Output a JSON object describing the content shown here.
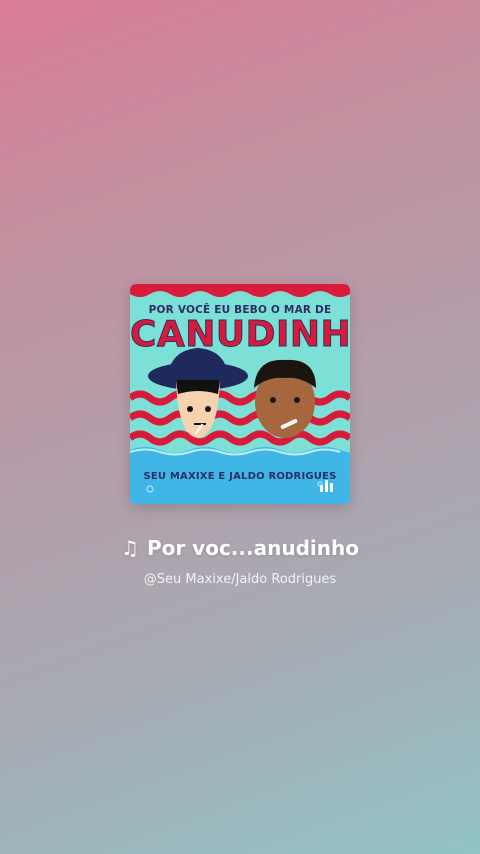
{
  "cover": {
    "top_text": "POR VOCÊ EU BEBO O MAR DE",
    "title_text": "CANUDINHO",
    "artists_text": "SEU MAXIXE E JALDO RODRIGUES",
    "icon": "playing-bars-icon",
    "colors": {
      "background": "#7de0d6",
      "waves": "#d81b3a",
      "water": "#3fb6e6",
      "text_dark": "#2c2f63"
    }
  },
  "song": {
    "note_icon": "♫",
    "title": "Por voc...anudinho",
    "artist": "@Seu Maxixe/Jaldo Rodrigues"
  }
}
